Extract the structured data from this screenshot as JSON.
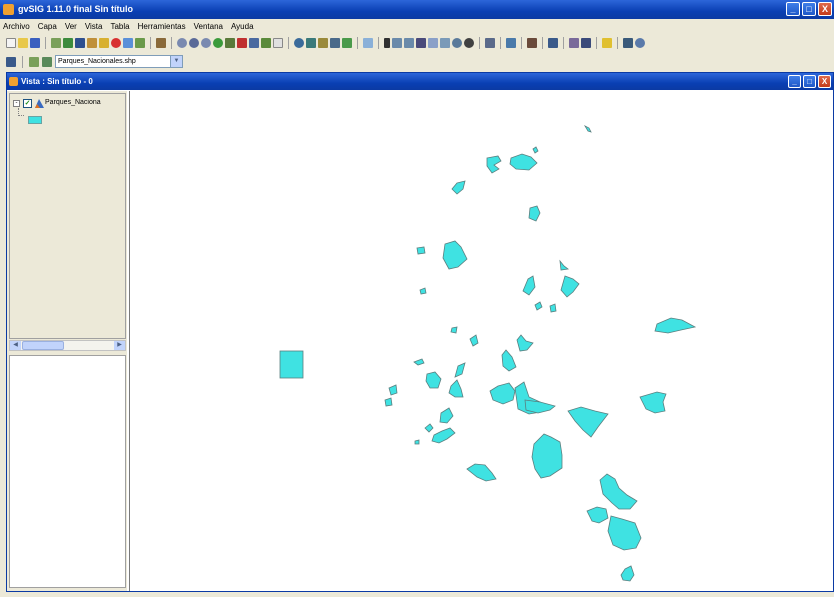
{
  "app": {
    "title": "gvSIG 1.11.0 final Sin título",
    "window_buttons": [
      "_",
      "□",
      "X"
    ]
  },
  "menu": [
    "Archivo",
    "Capa",
    "Ver",
    "Vista",
    "Tabla",
    "Herramientas",
    "Ventana",
    "Ayuda"
  ],
  "toolbar2": {
    "layer_combo_value": "Parques_Nacionales.shp"
  },
  "view": {
    "title": "Vista : Sin título - 0",
    "window_buttons": [
      "_",
      "□",
      "X"
    ]
  },
  "toc": {
    "layer_name": "Parques_Naciona",
    "layer_checked": true,
    "expander": "-"
  },
  "colors": {
    "polygon_fill": "#3fe2e2",
    "polygon_stroke": "#5a7f7f",
    "titlebar": "#0a3fb3"
  }
}
